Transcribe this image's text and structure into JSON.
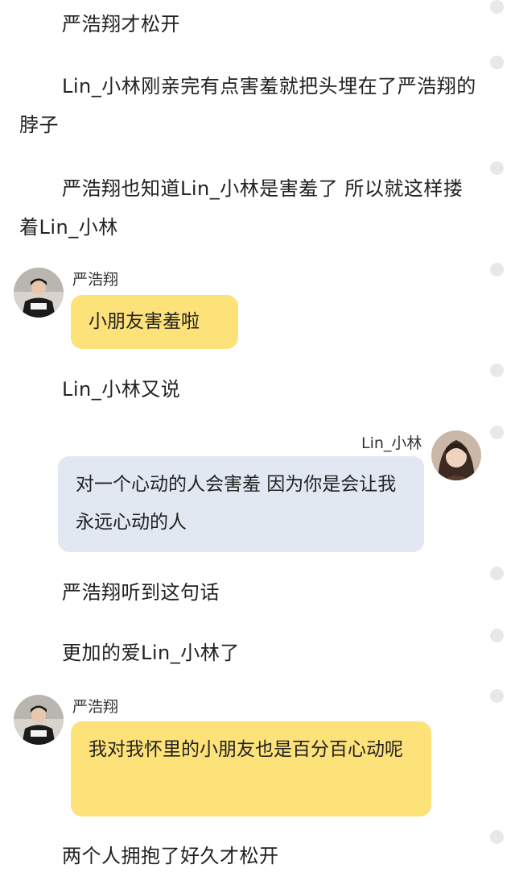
{
  "messages": {
    "p1": "严浩翔才松开",
    "p2": "Lin_小林刚亲完有点害羞就把头埋在了严浩翔的脖子",
    "p3": "严浩翔也知道Lin_小林是害羞了 所以就这样搂着Lin_小林",
    "c1_name": "严浩翔",
    "c1_text": "小朋友害羞啦",
    "p4": "Lin_小林又说",
    "c2_name": "Lin_小林",
    "c2_text": "对一个心动的人会害羞 因为你是会让我永远心动的人",
    "p5": "严浩翔听到这句话",
    "p6": "更加的爱Lin_小林了",
    "c3_name": "严浩翔",
    "c3_text": "我对我怀里的小朋友也是百分百心动呢",
    "p7": "两个人拥抱了好久才松开"
  },
  "colors": {
    "yellow_bubble": "#fde27a",
    "blue_bubble": "#e2e8f2",
    "dot": "#e8e8e8"
  },
  "icons": {
    "avatar_male": "avatar-yan-haoxiang",
    "avatar_female": "avatar-lin-xiaolin",
    "comment_dot": "comment-dot-icon"
  }
}
